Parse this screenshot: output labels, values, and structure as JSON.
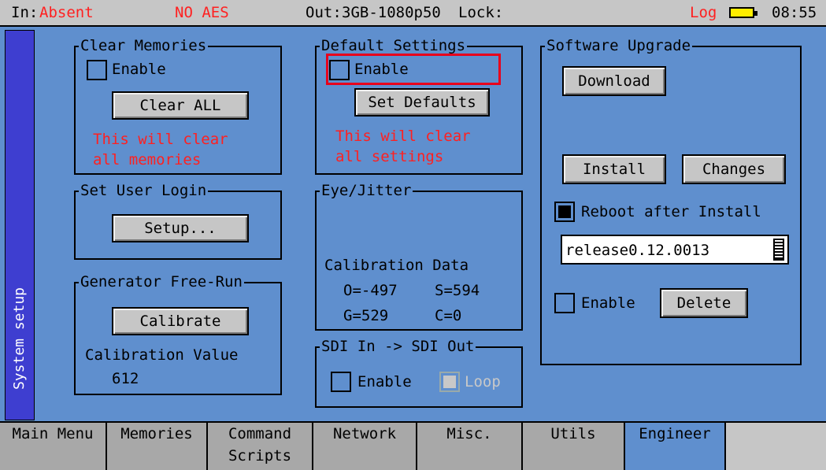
{
  "status": {
    "in_label": "In:",
    "in_value": "Absent",
    "aes": "NO AES",
    "out_label": "Out:",
    "out_value": "3GB-1080p50",
    "lock_label": "Lock:",
    "log": "Log",
    "time": "08:55"
  },
  "sidebar": {
    "label": "System setup"
  },
  "clear_memories": {
    "title": "Clear Memories",
    "enable_label": "Enable",
    "button": "Clear ALL",
    "warning_1": "This will clear",
    "warning_2": "all memories"
  },
  "default_settings": {
    "title": "Default Settings",
    "enable_label": "Enable",
    "button": "Set Defaults",
    "warning_1": "This will clear",
    "warning_2": "all settings"
  },
  "user_login": {
    "title": "Set User Login",
    "button": "Setup..."
  },
  "generator": {
    "title": "Generator Free-Run",
    "button": "Calibrate",
    "cal_label": "Calibration Value",
    "cal_value": "612"
  },
  "eye_jitter": {
    "title": "Eye/Jitter",
    "cal_label": "Calibration Data",
    "o": "O=-497",
    "s": "S=594",
    "g": "G=529",
    "c": "C=0"
  },
  "sdi": {
    "title": "SDI In -> SDI Out",
    "enable_label": "Enable",
    "loop_label": "Loop"
  },
  "software": {
    "title": "Software Upgrade",
    "download": "Download",
    "install": "Install",
    "changes": "Changes",
    "reboot_label": "Reboot after Install",
    "reboot_checked": true,
    "release_value": "release0.12.0013",
    "enable_label": "Enable",
    "delete": "Delete"
  },
  "tabs": [
    {
      "line1": "Main Menu",
      "line2": ""
    },
    {
      "line1": "Memories",
      "line2": ""
    },
    {
      "line1": "Command",
      "line2": "Scripts"
    },
    {
      "line1": "Network",
      "line2": ""
    },
    {
      "line1": "Misc.",
      "line2": ""
    },
    {
      "line1": "Utils",
      "line2": ""
    },
    {
      "line1": "Engineer",
      "line2": ""
    }
  ],
  "colors": {
    "background": "#5f8fce",
    "sidebar": "#3e3ed0",
    "warning": "#ff2020",
    "highlight": "#e8001c",
    "battery": "#ffee00"
  }
}
